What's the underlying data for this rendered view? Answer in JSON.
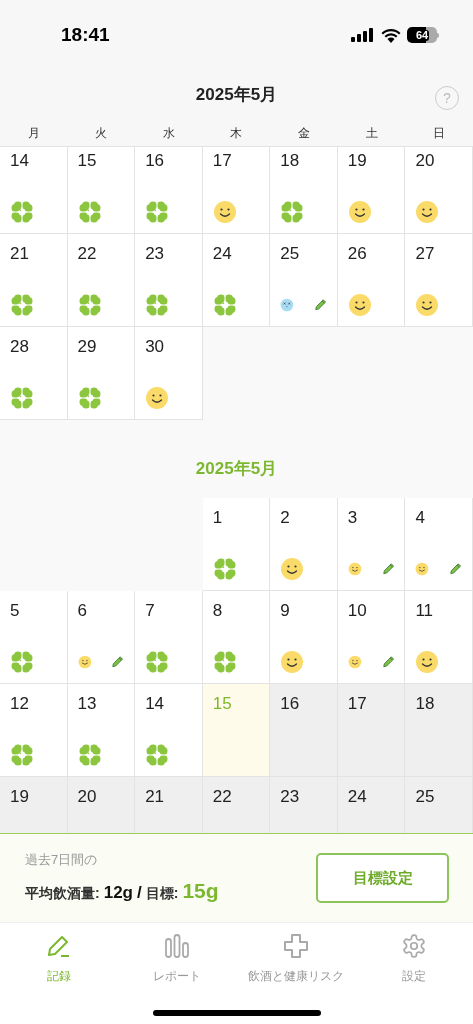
{
  "status_bar": {
    "time": "18:41",
    "battery": "64"
  },
  "header": {
    "help": "?"
  },
  "weekdays": [
    "月",
    "火",
    "水",
    "木",
    "金",
    "土",
    "日"
  ],
  "months": [
    {
      "title": "2025年5月",
      "selected": false,
      "weeks": [
        [
          {
            "day": "14",
            "kind": "clover",
            "edited": false
          },
          {
            "day": "15",
            "kind": "clover",
            "edited": false
          },
          {
            "day": "16",
            "kind": "clover",
            "edited": false
          },
          {
            "day": "17",
            "kind": "smile",
            "edited": false
          },
          {
            "day": "18",
            "kind": "clover",
            "edited": false
          },
          {
            "day": "19",
            "kind": "smile",
            "edited": false
          },
          {
            "day": "20",
            "kind": "smile",
            "edited": false
          }
        ],
        [
          {
            "day": "21",
            "kind": "clover",
            "edited": false
          },
          {
            "day": "22",
            "kind": "clover",
            "edited": false
          },
          {
            "day": "23",
            "kind": "clover",
            "edited": false
          },
          {
            "day": "24",
            "kind": "clover",
            "edited": false
          },
          {
            "day": "25",
            "kind": "dizzy",
            "edited": true
          },
          {
            "day": "26",
            "kind": "smile",
            "edited": false
          },
          {
            "day": "27",
            "kind": "smile",
            "edited": false
          }
        ],
        [
          {
            "day": "28",
            "kind": "clover",
            "edited": false
          },
          {
            "day": "29",
            "kind": "clover",
            "edited": false
          },
          {
            "day": "30",
            "kind": "smile",
            "edited": false
          },
          {
            "kind": "blank"
          },
          {
            "kind": "blank"
          },
          {
            "kind": "blank"
          },
          {
            "kind": "blank"
          }
        ]
      ]
    },
    {
      "title": "2025年5月",
      "selected": true,
      "weeks": [
        [
          {
            "kind": "blank"
          },
          {
            "kind": "blank"
          },
          {
            "kind": "blank"
          },
          {
            "day": "1",
            "kind": "clover",
            "edited": false
          },
          {
            "day": "2",
            "kind": "smile",
            "edited": false
          },
          {
            "day": "3",
            "kind": "smile",
            "edited": true
          },
          {
            "day": "4",
            "kind": "smile",
            "edited": true
          }
        ],
        [
          {
            "day": "5",
            "kind": "clover",
            "edited": false
          },
          {
            "day": "6",
            "kind": "smile",
            "edited": true
          },
          {
            "day": "7",
            "kind": "clover",
            "edited": false
          },
          {
            "day": "8",
            "kind": "clover",
            "edited": false
          },
          {
            "day": "9",
            "kind": "smile",
            "edited": false
          },
          {
            "day": "10",
            "kind": "smile",
            "edited": true
          },
          {
            "day": "11",
            "kind": "smile",
            "edited": false
          }
        ],
        [
          {
            "day": "12",
            "kind": "clover",
            "edited": false
          },
          {
            "day": "13",
            "kind": "clover",
            "edited": false
          },
          {
            "day": "14",
            "kind": "clover",
            "edited": false
          },
          {
            "day": "15",
            "kind": "empty",
            "today": true
          },
          {
            "day": "16",
            "kind": "empty",
            "future": true
          },
          {
            "day": "17",
            "kind": "empty",
            "future": true
          },
          {
            "day": "18",
            "kind": "empty",
            "future": true
          }
        ],
        [
          {
            "day": "19",
            "kind": "empty",
            "future": true
          },
          {
            "day": "20",
            "kind": "empty",
            "future": true
          },
          {
            "day": "21",
            "kind": "empty",
            "future": true
          },
          {
            "day": "22",
            "kind": "empty",
            "future": true
          },
          {
            "day": "23",
            "kind": "empty",
            "future": true
          },
          {
            "day": "24",
            "kind": "empty",
            "future": true
          },
          {
            "day": "25",
            "kind": "empty",
            "future": true
          }
        ]
      ]
    }
  ],
  "summary": {
    "caption": "過去7日間の",
    "avg_label": "平均飲酒量:",
    "avg_value": "12g",
    "separator": "/",
    "goal_label": "目標:",
    "goal_value": "15g",
    "button": "目標設定"
  },
  "tabs": [
    {
      "kind": "record",
      "label": "記録",
      "selected": true
    },
    {
      "kind": "report",
      "label": "レポート",
      "selected": false
    },
    {
      "kind": "health",
      "label": "飲酒と健康リスク",
      "selected": false
    },
    {
      "kind": "settings",
      "label": "設定",
      "selected": false
    }
  ]
}
